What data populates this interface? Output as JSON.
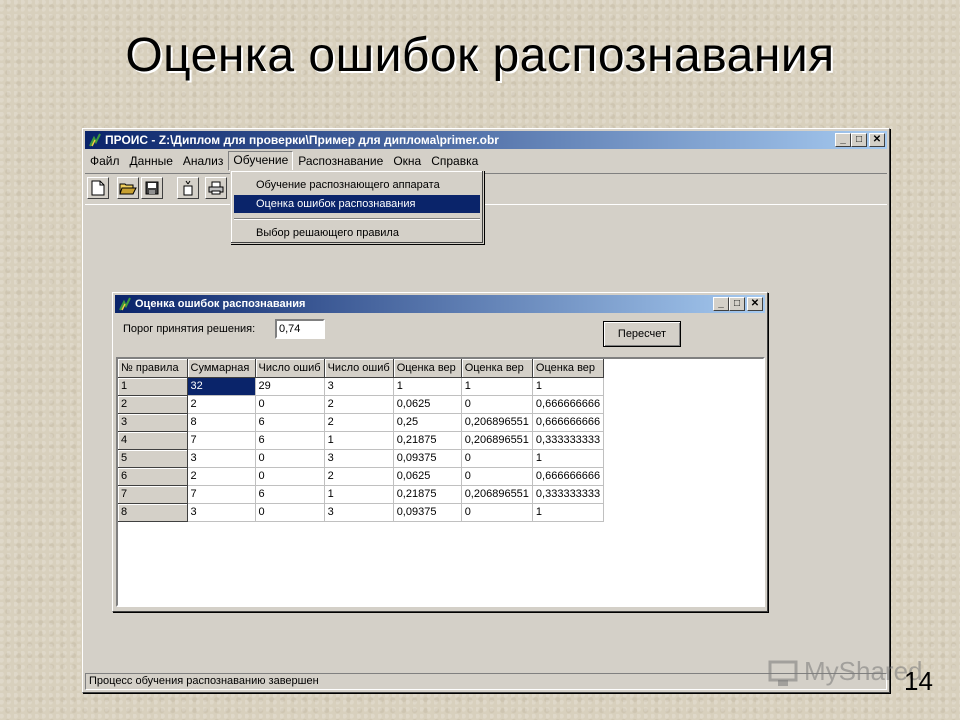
{
  "slide": {
    "title": "Оценка ошибок распознавания",
    "number": "14",
    "watermark": "MyShared"
  },
  "app": {
    "title": "ПРОИС - Z:\\Диплом для проверки\\Пример для диплома\\primer.obr",
    "menu": [
      "Файл",
      "Данные",
      "Анализ",
      "Обучение",
      "Распознавание",
      "Окна",
      "Справка"
    ],
    "open_menu": "Обучение",
    "status": "Процесс обучения распознаванию завершен",
    "window_buttons": {
      "minimize": "_",
      "maximize": "□",
      "close": "✕"
    }
  },
  "dropdown": {
    "items": [
      {
        "label": "Обучение распознающего аппарата",
        "selected": false
      },
      {
        "label": "Оценка ошибок распознавания",
        "selected": true
      },
      {
        "label": "Выбор решающего правила",
        "selected": false
      }
    ]
  },
  "toolbar": {
    "buttons": [
      "new-file-icon",
      "open-folder-icon",
      "save-disk-icon",
      "wizard-icon",
      "print-icon"
    ]
  },
  "child": {
    "title": "Оценка ошибок распознавания",
    "threshold_label": "Порог принятия решения:",
    "threshold_value": "0,74",
    "recalc_label": "Пересчет",
    "columns": [
      "№ правила",
      "Суммарная",
      "Число ошиб",
      "Число ошиб",
      "Оценка вер",
      "Оценка вер",
      "Оценка вер"
    ],
    "rows": [
      [
        "1",
        "32",
        "29",
        "3",
        "1",
        "1",
        "1"
      ],
      [
        "2",
        "2",
        "0",
        "2",
        "0,0625",
        "0",
        "0,666666666"
      ],
      [
        "3",
        "8",
        "6",
        "2",
        "0,25",
        "0,206896551",
        "0,666666666"
      ],
      [
        "4",
        "7",
        "6",
        "1",
        "0,21875",
        "0,206896551",
        "0,333333333"
      ],
      [
        "5",
        "3",
        "0",
        "3",
        "0,09375",
        "0",
        "1"
      ],
      [
        "6",
        "2",
        "0",
        "2",
        "0,0625",
        "0",
        "0,666666666"
      ],
      [
        "7",
        "7",
        "6",
        "1",
        "0,21875",
        "0,206896551",
        "0,333333333"
      ],
      [
        "8",
        "3",
        "0",
        "3",
        "0,09375",
        "0",
        "1"
      ]
    ]
  },
  "colors": {
    "titlebar_start": "#0a246a",
    "titlebar_end": "#a6caf0",
    "selection": "#0a246a",
    "face": "#d4d0c8"
  }
}
